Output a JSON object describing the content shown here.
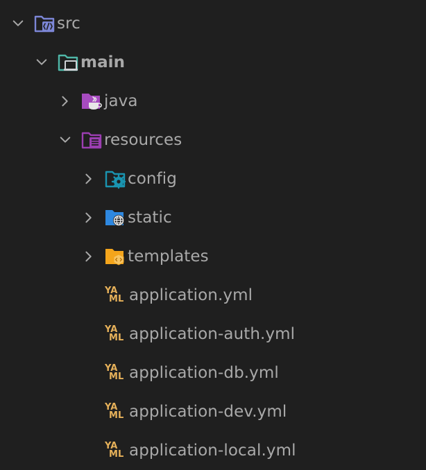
{
  "colors": {
    "background": "#1f1f1f",
    "text": "#a9a9a9",
    "src_folder": "#7c86d6",
    "main_folder": "#4fb7a8",
    "java_folder": "#a64bbf",
    "resources_folder": "#9b3eb1",
    "config_folder": "#1a94b0",
    "static_folder": "#2e88e0",
    "templates_folder": "#f4a51c",
    "yaml_icon": "#e6b15a"
  },
  "tree": {
    "src": {
      "label": "src",
      "icon": "folder-source-icon",
      "expanded": true
    },
    "main": {
      "label": "main",
      "icon": "folder-main-icon",
      "expanded": true
    },
    "java": {
      "label": "java",
      "icon": "folder-java-icon",
      "expanded": false
    },
    "resources": {
      "label": "resources",
      "icon": "folder-resources-icon",
      "expanded": true
    },
    "config": {
      "label": "config",
      "icon": "folder-config-icon",
      "expanded": false
    },
    "static": {
      "label": "static",
      "icon": "folder-static-icon",
      "expanded": false
    },
    "templates": {
      "label": "templates",
      "icon": "folder-templates-icon",
      "expanded": false
    },
    "files": [
      {
        "label": "application.yml",
        "icon": "yaml-file-icon",
        "icon_text_top": "YA",
        "icon_text_bottom": "ML"
      },
      {
        "label": "application-auth.yml",
        "icon": "yaml-file-icon",
        "icon_text_top": "YA",
        "icon_text_bottom": "ML"
      },
      {
        "label": "application-db.yml",
        "icon": "yaml-file-icon",
        "icon_text_top": "YA",
        "icon_text_bottom": "ML"
      },
      {
        "label": "application-dev.yml",
        "icon": "yaml-file-icon",
        "icon_text_top": "YA",
        "icon_text_bottom": "ML"
      },
      {
        "label": "application-local.yml",
        "icon": "yaml-file-icon",
        "icon_text_top": "YA",
        "icon_text_bottom": "ML"
      }
    ]
  }
}
